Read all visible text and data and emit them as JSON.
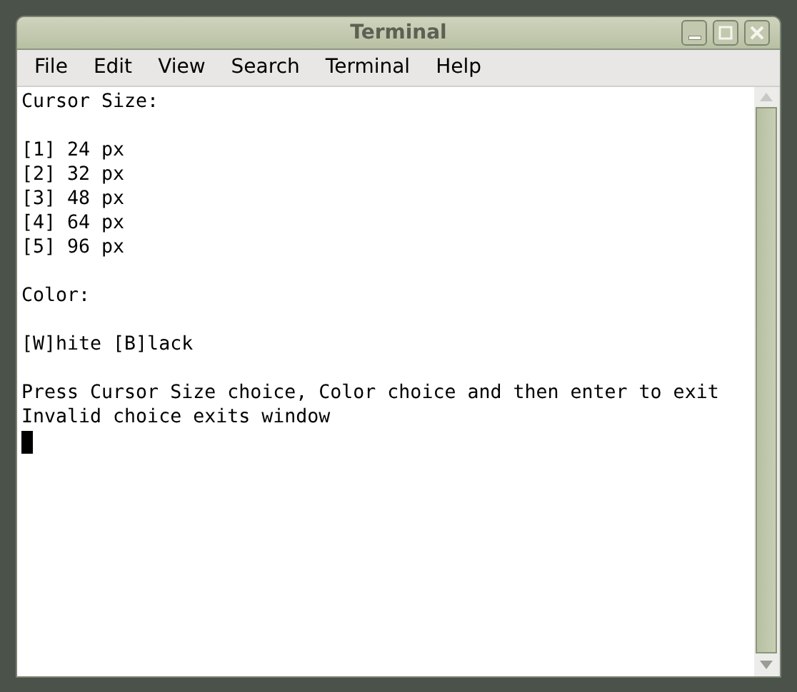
{
  "window": {
    "title": "Terminal"
  },
  "menu": [
    "File",
    "Edit",
    "View",
    "Search",
    "Terminal",
    "Help"
  ],
  "lines": [
    {
      "kind": "text",
      "text": "Cursor Size:"
    },
    {
      "kind": "blank"
    },
    {
      "kind": "text",
      "text": "[1] 24 px"
    },
    {
      "kind": "text",
      "text": "[2] 32 px"
    },
    {
      "kind": "text",
      "text": "[3] 48 px"
    },
    {
      "kind": "text",
      "text": "[4] 64 px"
    },
    {
      "kind": "text",
      "text": "[5] 96 px"
    },
    {
      "kind": "blank"
    },
    {
      "kind": "text",
      "text": "Color:"
    },
    {
      "kind": "blank"
    },
    {
      "kind": "text",
      "text": "[W]hite [B]lack"
    },
    {
      "kind": "blank"
    },
    {
      "kind": "text",
      "text": "Press Cursor Size choice, Color choice and then enter to exit"
    },
    {
      "kind": "text",
      "text": "Invalid choice exits window"
    },
    {
      "kind": "cursor"
    }
  ]
}
